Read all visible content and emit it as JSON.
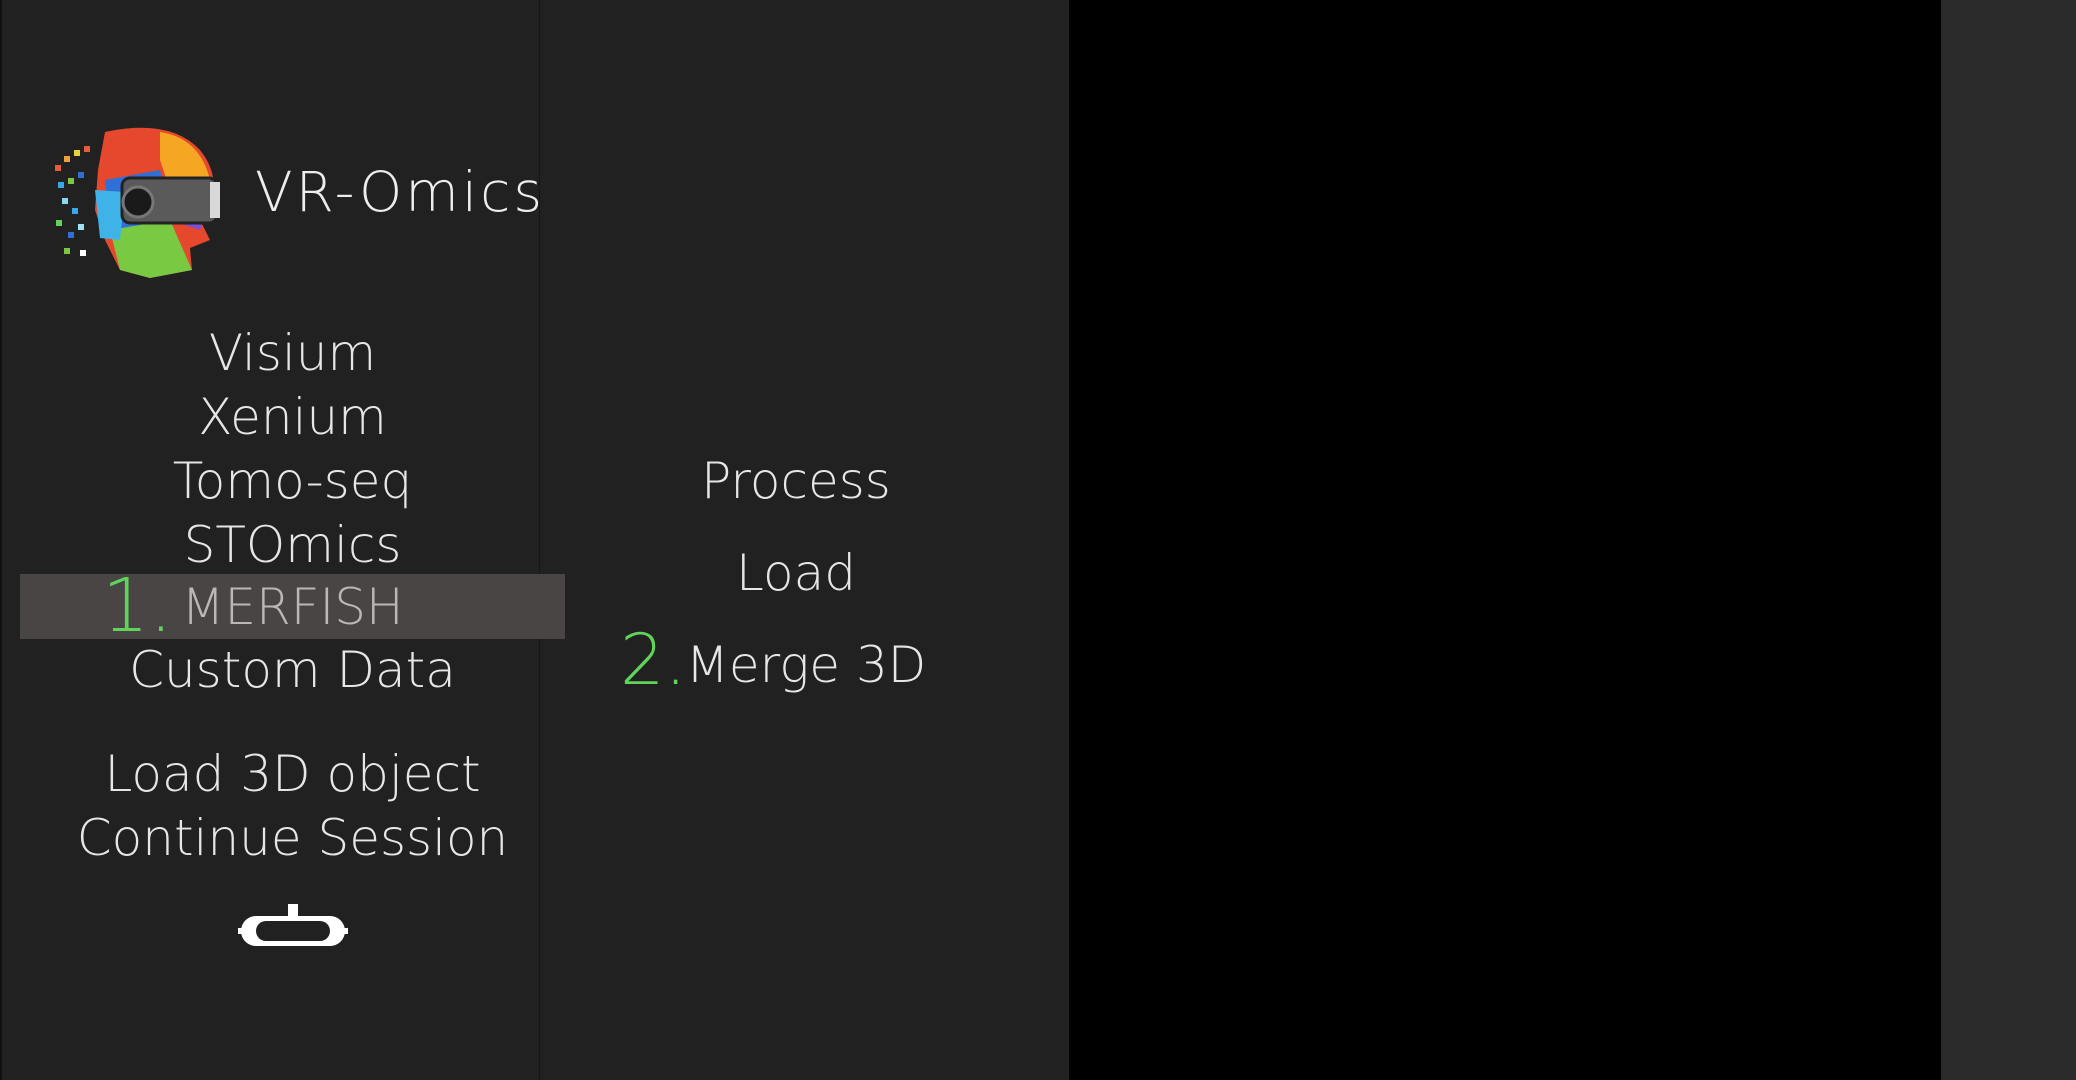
{
  "app": {
    "title": "VR-Omics"
  },
  "left_menu": {
    "items": [
      {
        "label": "Visium"
      },
      {
        "label": "Xenium"
      },
      {
        "label": "Tomo-seq"
      },
      {
        "label": "STOmics"
      },
      {
        "label": "MERFISH",
        "selected": true
      },
      {
        "label": "Custom Data"
      }
    ],
    "extra": [
      {
        "label": "Load 3D object"
      },
      {
        "label": "Continue Session"
      }
    ],
    "step_marker": "1."
  },
  "mid_menu": {
    "items": [
      {
        "label": "Process"
      },
      {
        "label": "Load"
      },
      {
        "label": "Merge 3D"
      }
    ],
    "step_marker": "2."
  },
  "icons": {
    "logo": "vr-omics-logo",
    "vr_headset": "vr-headset-icon"
  },
  "colors": {
    "accent": "#5fd35a",
    "selected_bg": "#4a4545",
    "panel_bg": "#212121"
  }
}
